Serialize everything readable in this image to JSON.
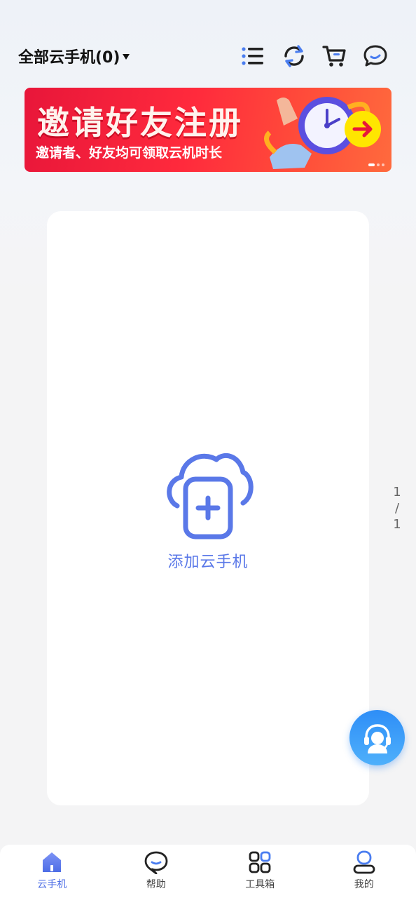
{
  "header": {
    "title": "全部云手机(0)"
  },
  "banner": {
    "title": "邀请好友注册",
    "subtitle": "邀请者、好友均可领取云机时长",
    "slides": 3,
    "active_slide": 1
  },
  "main": {
    "add_label": "添加云手机"
  },
  "pager": {
    "current": "1",
    "separator": "/",
    "total": "1"
  },
  "tabs": [
    {
      "label": "云手机",
      "active": true
    },
    {
      "label": "帮助",
      "active": false
    },
    {
      "label": "工具箱",
      "active": false
    },
    {
      "label": "我的",
      "active": false
    }
  ],
  "colors": {
    "accent": "#5a78e8",
    "banner_red": "#ff2a3c",
    "support_blue": "#2e8ef7"
  },
  "icons": [
    "list-icon",
    "refresh-icon",
    "cart-icon",
    "message-icon",
    "cloud-add-icon",
    "customer-service-icon",
    "home-icon",
    "help-icon",
    "toolbox-icon",
    "profile-icon"
  ]
}
